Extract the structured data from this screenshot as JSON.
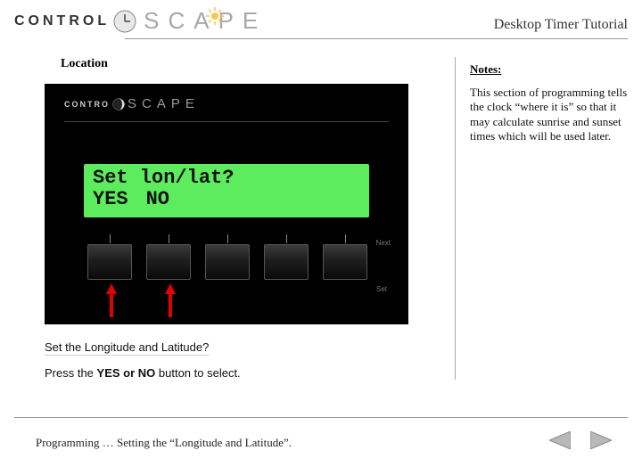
{
  "header": {
    "logo_control": "CONTROL",
    "logo_scape": "SCAPE",
    "title": "Desktop Timer Tutorial"
  },
  "section": {
    "title": "Location"
  },
  "device": {
    "logo_control": "CONTRO",
    "logo_scape": "SCAPE",
    "lcd_line1": "Set lon/lat?",
    "lcd_yes": "YES",
    "lcd_no": "NO",
    "label_next": "Next",
    "label_set": "Set"
  },
  "instructions": {
    "line1": "Set the Longitude and Latitude?",
    "line2_pre": "Press the ",
    "line2_bold": "YES or NO",
    "line2_post": " button to select."
  },
  "notes": {
    "title": "Notes:",
    "body": "This section of programming tells the clock “where it is” so that it may calculate sunrise and sunset times which will be used later."
  },
  "footer": {
    "text": "Programming … Setting the “Longitude and Latitude”."
  }
}
